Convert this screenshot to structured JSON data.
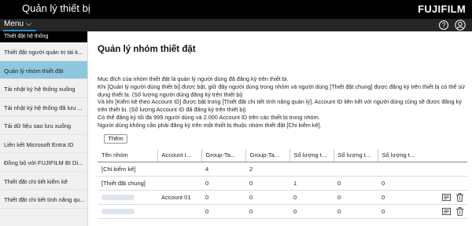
{
  "header": {
    "title": "Quản lý thiết bị",
    "brand": "FUJIFILM"
  },
  "subbar": {
    "menu_label": "Menu",
    "help_symbol": "?"
  },
  "sidebar": {
    "section_title": "Thiết đặt hệ thống",
    "items": [
      {
        "label": "Thiết đặt người quản trị tài k..."
      },
      {
        "label": "Quản lý nhóm thiết đặt"
      },
      {
        "label": "Tải nhật ký hệ thống xuống"
      },
      {
        "label": "Tải nhật ký hệ thống đã lưu ..."
      },
      {
        "label": "Tải dữ liệu sao lưu xuống"
      },
      {
        "label": "Liên kết Microsoft Entra ID"
      },
      {
        "label": "Đồng bộ với FUJIFILM BI Di..."
      },
      {
        "label": "Thiết đặt chi tiết kiểm kê"
      },
      {
        "label": "Thiết đặt chi tiết tính năng qu..."
      }
    ]
  },
  "main": {
    "title": "Quản lý nhóm thiết đặt",
    "description": [
      "Mục đích của nhóm thiết đặt là quản lý người dùng đã đăng ký trên thiết bị.",
      "Khi [Quản lý người dùng thiết bị] được bật, giữ đây người dùng trong nhóm và người dùng [Thiết đặt chung] được đăng ký trên thiết bị có thể sử dụng thiết bị. (Số lượng người dùng đăng ký trên thiết bị)",
      "Và khi [Kiểm kê theo Account ID] được bật trong [Thiết đặt chi tiết tính năng quản lý], Account ID liên kết với người dùng cũng sẽ được đăng ký trên thiết bị. (Số lượng Account ID đã đăng ký trên thiết bị)",
      "Có thể đăng ký tối đa 999 người dùng và 2.000 Account ID trên các thiết bị trong nhóm.",
      "Người dùng không cần phải đăng ký trên một thiết bị thuộc nhóm thiết đặt [Chi kiểm kê]."
    ],
    "add_button": "Thêm",
    "table": {
      "headers": [
        "Tên nhóm",
        "Account I...",
        "Group-Ta...",
        "Group-Ta...",
        "Số lượng t...",
        "Số lượng t...",
        "Số lượng t..."
      ],
      "rows": [
        [
          "[Chỉ kiểm kê]",
          "",
          "4",
          "2",
          "",
          "",
          ""
        ],
        [
          "[Thiết đặt chung]",
          "",
          "0",
          "0",
          "1",
          "0",
          "0"
        ],
        [
          "",
          "Account 01",
          "0",
          "0",
          "0",
          "0",
          "0"
        ],
        [
          "",
          "",
          "0",
          "0",
          "0",
          "0",
          "0"
        ]
      ]
    }
  },
  "colors": {
    "topbar": "#000000",
    "accent": "#2d8fcc",
    "active_item": "#8ec7de"
  }
}
